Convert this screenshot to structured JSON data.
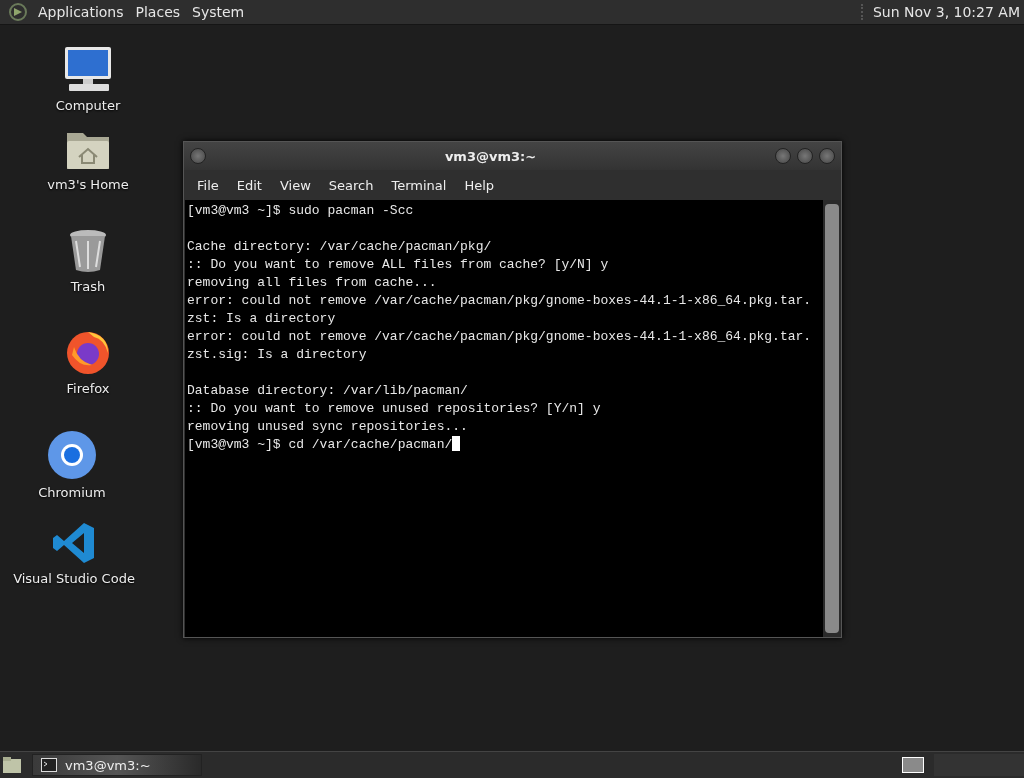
{
  "top_panel": {
    "menus": [
      "Applications",
      "Places",
      "System"
    ],
    "clock": "Sun Nov 3, 10:27 AM"
  },
  "desktop_icons": [
    {
      "kind": "computer",
      "label": "Computer"
    },
    {
      "kind": "home",
      "label": "vm3's Home"
    },
    {
      "kind": "trash",
      "label": "Trash"
    },
    {
      "kind": "firefox",
      "label": "Firefox"
    },
    {
      "kind": "chromium",
      "label": "Chromium"
    },
    {
      "kind": "vscode",
      "label": "Visual Studio Code"
    }
  ],
  "terminal": {
    "title": "vm3@vm3:~",
    "menu": [
      "File",
      "Edit",
      "View",
      "Search",
      "Terminal",
      "Help"
    ],
    "blocks": [
      [
        "[vm3@vm3 ~]$ sudo pacman -Scc"
      ],
      [
        "Cache directory: /var/cache/pacman/pkg/",
        ":: Do you want to remove ALL files from cache? [y/N] y",
        "removing all files from cache...",
        "error: could not remove /var/cache/pacman/pkg/gnome-boxes-44.1-1-x86_64.pkg.tar.",
        "zst: Is a directory",
        "error: could not remove /var/cache/pacman/pkg/gnome-boxes-44.1-1-x86_64.pkg.tar.",
        "zst.sig: Is a directory"
      ],
      [
        "Database directory: /var/lib/pacman/",
        ":: Do you want to remove unused repositories? [Y/n] y",
        "removing unused sync repositories...",
        "[vm3@vm3 ~]$ cd /var/cache/pacman/"
      ]
    ],
    "cursor": true
  },
  "bottom_panel": {
    "tasks": [
      {
        "label": "vm3@vm3:~",
        "selected": false
      }
    ]
  }
}
